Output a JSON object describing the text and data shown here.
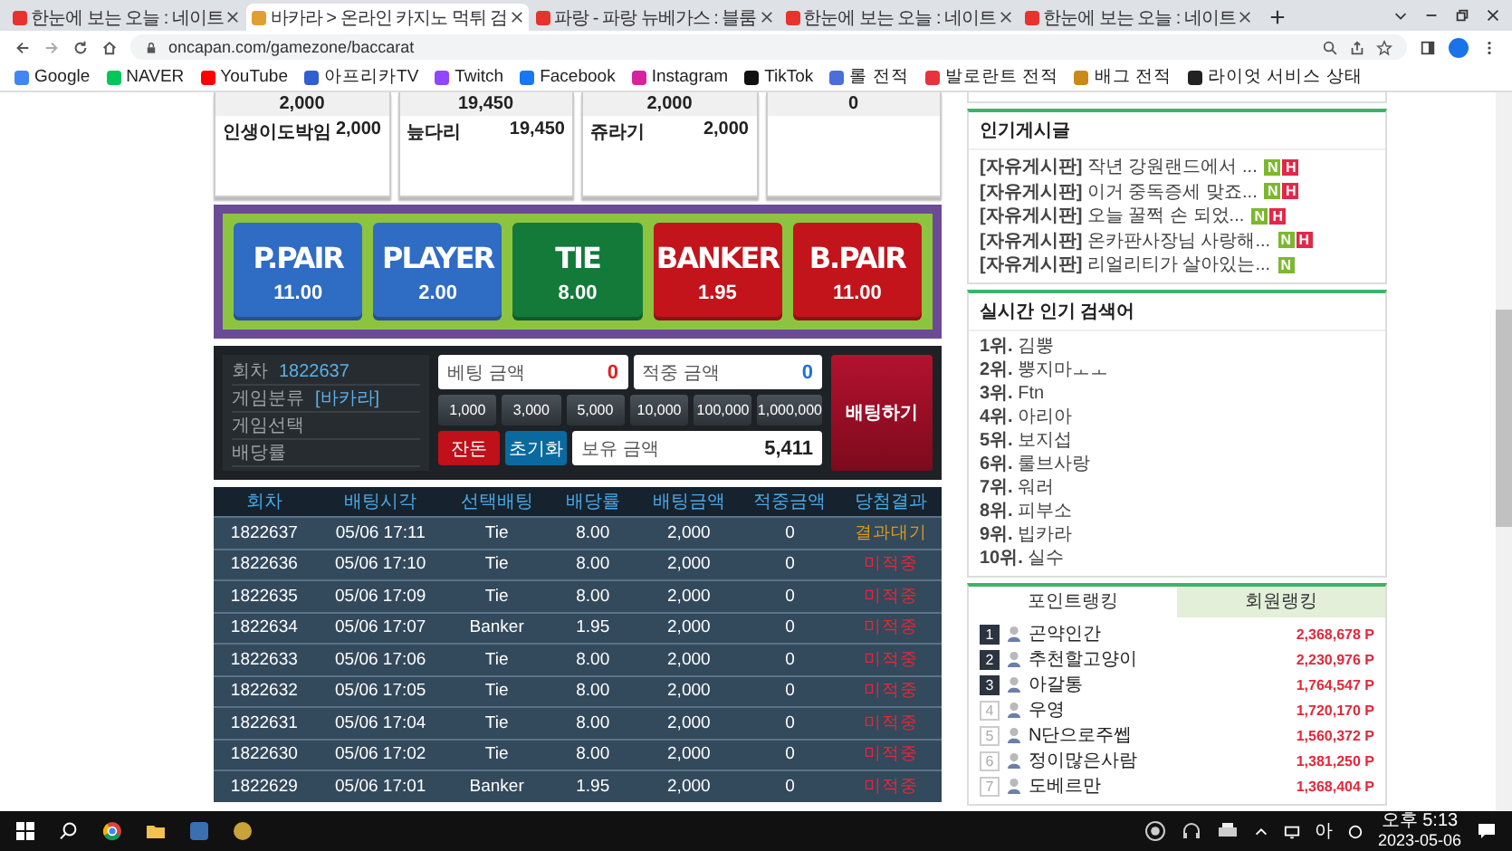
{
  "browser": {
    "tabs": [
      {
        "title": "한눈에 보는 오늘 : 네이트",
        "selected": false,
        "color": "#e8322e"
      },
      {
        "title": "바카라 > 온라인 카지노 먹튀 검",
        "selected": true,
        "color": "#e0a030"
      },
      {
        "title": "파랑 - 파랑 뉴베가스 : 블룸",
        "selected": false,
        "color": "#e8322e"
      },
      {
        "title": "한눈에 보는 오늘 : 네이트",
        "selected": false,
        "color": "#e8322e"
      },
      {
        "title": "한눈에 보는 오늘 : 네이트",
        "selected": false,
        "color": "#e8322e"
      }
    ],
    "url": "oncapan.com/gamezone/baccarat",
    "bookmarks": [
      {
        "label": "Google",
        "color": "#4285f4"
      },
      {
        "label": "NAVER",
        "color": "#03c75a"
      },
      {
        "label": "YouTube",
        "color": "#ff0000"
      },
      {
        "label": "아프리카TV",
        "color": "#2f5fd0"
      },
      {
        "label": "Twitch",
        "color": "#9146ff"
      },
      {
        "label": "Facebook",
        "color": "#1877f2"
      },
      {
        "label": "Instagram",
        "color": "#d6249f"
      },
      {
        "label": "TikTok",
        "color": "#111111"
      },
      {
        "label": "롤 전적",
        "color": "#4a6fd8"
      },
      {
        "label": "발로란트 전적",
        "color": "#e8323c"
      },
      {
        "label": "배그 전적",
        "color": "#c98a1a"
      },
      {
        "label": "라이엇 서비스 상태",
        "color": "#222222"
      }
    ]
  },
  "bet_cards": [
    {
      "total": "2,000",
      "rows": [
        {
          "name": "인생이도박임",
          "amount": "2,000"
        }
      ]
    },
    {
      "total": "19,450",
      "rows": [
        {
          "name": "늪다리",
          "amount": "19,450"
        }
      ]
    },
    {
      "total": "2,000",
      "rows": [
        {
          "name": "쥬라기",
          "amount": "2,000"
        }
      ]
    },
    {
      "total": "0"
    }
  ],
  "bet_options": [
    {
      "label": "P.PAIR",
      "odds": "11.00",
      "color": "#2f6cc3"
    },
    {
      "label": "PLAYER",
      "odds": "2.00",
      "color": "#2f6cc3"
    },
    {
      "label": "TIE",
      "odds": "8.00",
      "color": "#137a3a"
    },
    {
      "label": "BANKER",
      "odds": "1.95",
      "color": "#c3141b"
    },
    {
      "label": "B.PAIR",
      "odds": "11.00",
      "color": "#c3141b"
    }
  ],
  "bet_panel": {
    "info": [
      {
        "label": "회차",
        "value": "1822637"
      },
      {
        "label": "게임분류",
        "value": "[바카라]"
      },
      {
        "label": "게임선택"
      },
      {
        "label": "배당률"
      }
    ],
    "bet_amount": {
      "label": "베팅 금액",
      "value": "0"
    },
    "win_amount": {
      "label": "적중 금액",
      "value": "0"
    },
    "chips": [
      "1,000",
      "3,000",
      "5,000",
      "10,000",
      "100,000",
      "1,000,000"
    ],
    "change_button": "잔돈",
    "reset_button": "초기화",
    "balance": {
      "label": "보유 금액",
      "value": "5,411"
    },
    "submit_button": "배팅하기"
  },
  "history": {
    "columns": [
      "회차",
      "배팅시각",
      "선택배팅",
      "배당률",
      "배팅금액",
      "적중금액",
      "당첨결과"
    ],
    "rows": [
      {
        "round": "1822637",
        "time": "05/06 17:11",
        "pick": "Tie",
        "odds": "8.00",
        "amount": "2,000",
        "win": "0",
        "result": "결과대기",
        "pending": true
      },
      {
        "round": "1822636",
        "time": "05/06 17:10",
        "pick": "Tie",
        "odds": "8.00",
        "amount": "2,000",
        "win": "0",
        "result": "미적중",
        "pending": false
      },
      {
        "round": "1822635",
        "time": "05/06 17:09",
        "pick": "Tie",
        "odds": "8.00",
        "amount": "2,000",
        "win": "0",
        "result": "미적중",
        "pending": false
      },
      {
        "round": "1822634",
        "time": "05/06 17:07",
        "pick": "Banker",
        "odds": "1.95",
        "amount": "2,000",
        "win": "0",
        "result": "미적중",
        "pending": false
      },
      {
        "round": "1822633",
        "time": "05/06 17:06",
        "pick": "Tie",
        "odds": "8.00",
        "amount": "2,000",
        "win": "0",
        "result": "미적중",
        "pending": false
      },
      {
        "round": "1822632",
        "time": "05/06 17:05",
        "pick": "Tie",
        "odds": "8.00",
        "amount": "2,000",
        "win": "0",
        "result": "미적중",
        "pending": false
      },
      {
        "round": "1822631",
        "time": "05/06 17:04",
        "pick": "Tie",
        "odds": "8.00",
        "amount": "2,000",
        "win": "0",
        "result": "미적중",
        "pending": false
      },
      {
        "round": "1822630",
        "time": "05/06 17:02",
        "pick": "Tie",
        "odds": "8.00",
        "amount": "2,000",
        "win": "0",
        "result": "미적중",
        "pending": false
      },
      {
        "round": "1822629",
        "time": "05/06 17:01",
        "pick": "Banker",
        "odds": "1.95",
        "amount": "2,000",
        "win": "0",
        "result": "미적중",
        "pending": false
      }
    ]
  },
  "popular_posts": {
    "title": "인기게시글",
    "items": [
      {
        "board": "[자유게시판]",
        "title": "작년 강원랜드에서 ...",
        "badges": [
          {
            "label": "N",
            "kind": "new"
          },
          {
            "label": "H",
            "kind": "hot"
          }
        ]
      },
      {
        "board": "[자유게시판]",
        "title": "이거 중독증세 맞죠...",
        "badges": [
          {
            "label": "N",
            "kind": "new"
          },
          {
            "label": "H",
            "kind": "hot"
          }
        ]
      },
      {
        "board": "[자유게시판]",
        "title": "오늘 꿀쩍 손 되었...",
        "badges": [
          {
            "label": "N",
            "kind": "new"
          },
          {
            "label": "H",
            "kind": "hot"
          }
        ]
      },
      {
        "board": "[자유게시판]",
        "title": "온카판사장님 사랑해...",
        "badges": [
          {
            "label": "N",
            "kind": "new"
          },
          {
            "label": "H",
            "kind": "hot"
          }
        ]
      },
      {
        "board": "[자유게시판]",
        "title": "리얼리티가 살아있는...",
        "badges": [
          {
            "label": "N",
            "kind": "new"
          }
        ]
      }
    ]
  },
  "search_ranking": {
    "title": "실시간 인기 검색어",
    "items": [
      {
        "rank": "1위.",
        "term": "김뿡"
      },
      {
        "rank": "2위.",
        "term": "뿡지마ㅗㅗ"
      },
      {
        "rank": "3위.",
        "term": "Ftn"
      },
      {
        "rank": "4위.",
        "term": "아리아"
      },
      {
        "rank": "5위.",
        "term": "보지섭"
      },
      {
        "rank": "6위.",
        "term": "룰브사랑"
      },
      {
        "rank": "7위.",
        "term": "워러"
      },
      {
        "rank": "8위.",
        "term": "피부소"
      },
      {
        "rank": "9위.",
        "term": "빕카라"
      },
      {
        "rank": "10위.",
        "term": "실수"
      }
    ]
  },
  "ranking": {
    "tabs": [
      {
        "label": "포인트랭킹",
        "selected": true
      },
      {
        "label": "회원랭킹",
        "selected": false
      }
    ],
    "items": [
      {
        "rank": "1",
        "name": "곤약인간",
        "points": "2,368,678 P",
        "top": true
      },
      {
        "rank": "2",
        "name": "추천할고양이",
        "points": "2,230,976 P",
        "top": true
      },
      {
        "rank": "3",
        "name": "아갈통",
        "points": "1,764,547 P",
        "top": true
      },
      {
        "rank": "4",
        "name": "우영",
        "points": "1,720,170 P",
        "top": false
      },
      {
        "rank": "5",
        "name": "N단으로주쎕",
        "points": "1,560,372 P",
        "top": false
      },
      {
        "rank": "6",
        "name": "정이많은사람",
        "points": "1,381,250 P",
        "top": false
      },
      {
        "rank": "7",
        "name": "도베르만",
        "points": "1,368,404 P",
        "top": false
      }
    ]
  },
  "taskbar": {
    "ime": "아",
    "time": "오후 5:13",
    "date": "2023-05-06"
  }
}
